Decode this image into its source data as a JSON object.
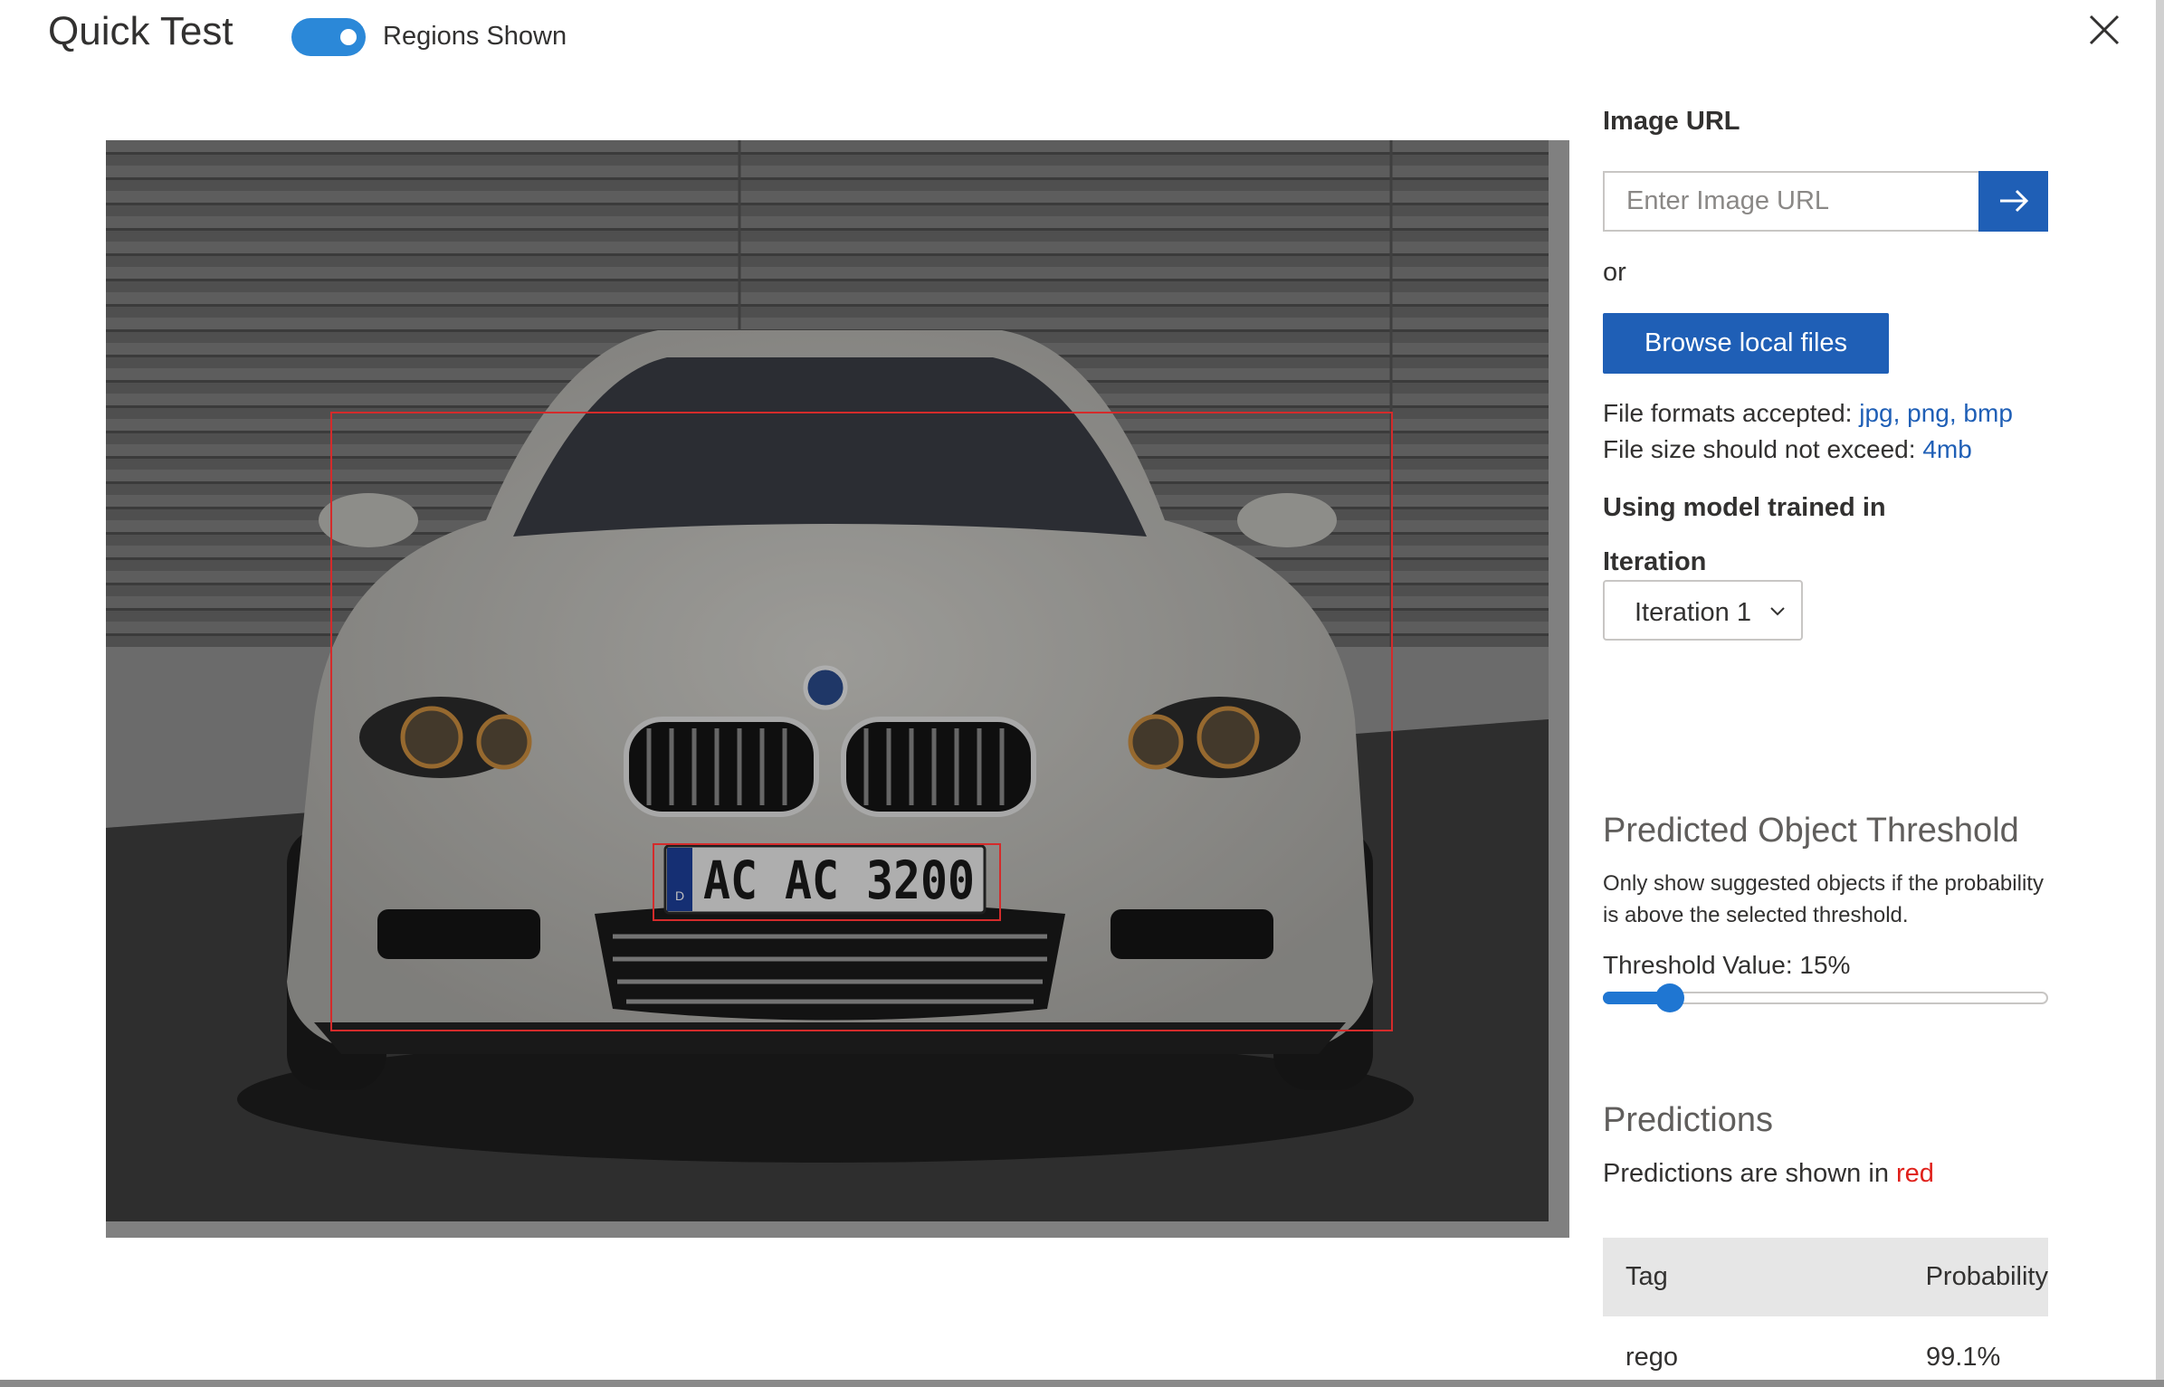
{
  "header": {
    "title": "Quick Test",
    "toggle_label": "Regions Shown",
    "toggle_on": true
  },
  "image": {
    "license_plate": "AC AC 3200",
    "plate_country": "D",
    "regions_color": "#d42b2b"
  },
  "panel": {
    "image_url_label": "Image URL",
    "image_url_placeholder": "Enter Image URL",
    "image_url_value": "",
    "or_text": "or",
    "browse_label": "Browse local files",
    "formats_prefix": "File formats accepted: ",
    "formats_value": "jpg, png, bmp",
    "size_prefix": "File size should not exceed: ",
    "size_value": "4mb",
    "model_label": "Using model trained in",
    "iteration_label": "Iteration",
    "iteration_selected": "Iteration 1"
  },
  "threshold": {
    "title": "Predicted Object Threshold",
    "description": "Only show suggested objects if the probability is above the selected threshold.",
    "value_label": "Threshold Value: 15%",
    "value_percent": 15
  },
  "predictions": {
    "title": "Predictions",
    "note_prefix": "Predictions are shown in ",
    "note_color_word": "red",
    "columns": [
      "Tag",
      "Probability"
    ],
    "rows": [
      {
        "tag": "rego",
        "probability": "99.1%"
      }
    ]
  },
  "colors": {
    "primary": "#1f5fb6",
    "toggle": "#2b88d8",
    "prediction_red": "#d42b2b"
  }
}
